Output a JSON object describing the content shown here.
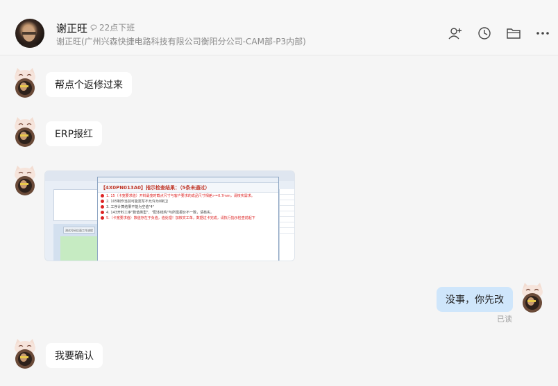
{
  "header": {
    "contact_name": "谢正旺",
    "status": "22点下班",
    "subtitle": "谢正旺(广州兴森快捷电路科技有限公司衡阳分公司-CAM部-P3内部)"
  },
  "window_controls": [
    "minimize-icon",
    "maximize-icon",
    "close-icon"
  ],
  "header_icons": [
    "add-member-icon",
    "history-clock-icon",
    "folder-icon",
    "more-icon"
  ],
  "messages": [
    {
      "from": "contact",
      "type": "text",
      "text": "帮点个返修过来"
    },
    {
      "from": "contact",
      "type": "text",
      "text": "ERP报红"
    },
    {
      "from": "contact",
      "type": "image",
      "screenshot": {
        "dialog_title": "【4X0PN013A0】指示检查结果：（5条未通过）",
        "lines": [
          {
            "text": "1. 15（卡宽要求值）开料最宽时截点尺寸与客户要求的成品尺寸相差>=0.7mm，请核实需求。",
            "color": "red"
          },
          {
            "text": "2. 105制作当前可能需写不允许为0制卫",
            "color": "dark"
          },
          {
            "text": "3. 工序计算结果不能为空值\"4\"",
            "color": "dark"
          },
          {
            "text": "4. 143开料工序\"数值类型\"、\"配本结构\"与所需报价不一致，请核实。",
            "color": "dark"
          },
          {
            "text": "5.（卡宽要求值）数值存在于负值，值处理！加核实工单，数据过卡完成，请执行指示检查前起下",
            "color": "red"
          }
        ],
        "left_tab": "测试号码后面工作流程"
      }
    },
    {
      "from": "me",
      "type": "text",
      "text": "没事，你先改",
      "read_label": "已读"
    },
    {
      "from": "contact",
      "type": "text",
      "text": "我要确认"
    }
  ]
}
